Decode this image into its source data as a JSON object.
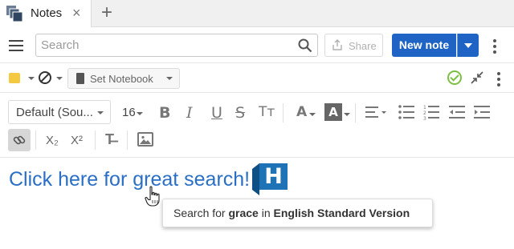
{
  "tabs": [
    {
      "label": "Notes",
      "close": "×"
    }
  ],
  "tab_add": "+",
  "header": {
    "search_placeholder": "Search",
    "share_label": "Share",
    "new_note_label": "New note"
  },
  "notebar": {
    "set_notebook_label": "Set Notebook"
  },
  "format": {
    "font_family": "Default (Sou...",
    "font_size": "16",
    "bold": "B",
    "italic": "I",
    "underline": "U",
    "strike": "S",
    "text_size": "Tт",
    "font_color": "A",
    "highlight": "A",
    "subscript": "X₂",
    "superscript": "X²",
    "clear_format": "T̶"
  },
  "content": {
    "link_text": "Click here for great search!",
    "logo_letter": "H"
  },
  "tooltip": {
    "prefix": "Search for ",
    "term": "grace",
    "middle": " in ",
    "version": "English Standard Version"
  },
  "colors": {
    "accent": "#1f64c4",
    "link": "#2a6fc5",
    "logo": "#1d73b5",
    "sticky": "#f5c842",
    "sync_ok": "#7cc043"
  }
}
